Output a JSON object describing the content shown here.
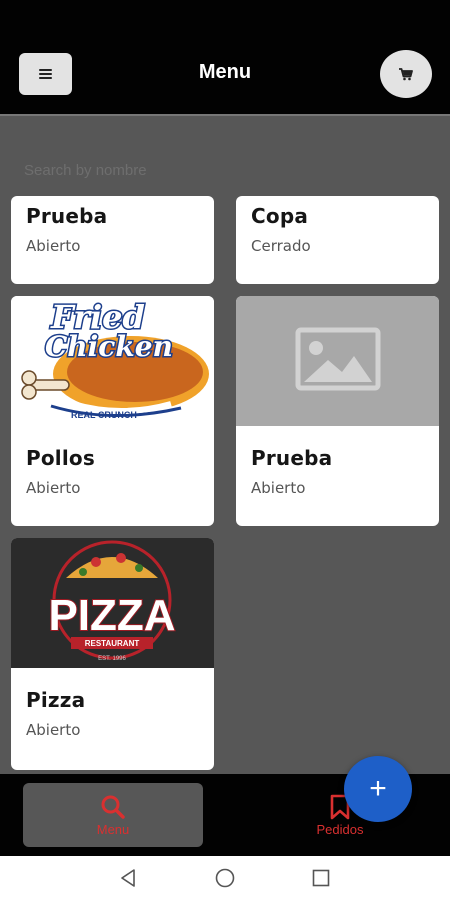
{
  "app_bar": {
    "title": "Menu",
    "menu_icon": "hamburger-icon",
    "cart_icon": "cart-icon"
  },
  "search": {
    "placeholder": "Search by nombre",
    "value": ""
  },
  "restaurants": [
    {
      "name": "Prueba",
      "status": "Abierto",
      "image": "none"
    },
    {
      "name": "Copa",
      "status": "Cerrado",
      "image": "none"
    },
    {
      "name": "Pollos",
      "status": "Abierto",
      "image": "fried-chicken-logo"
    },
    {
      "name": "Prueba",
      "status": "Abierto",
      "image": "image-placeholder-icon"
    },
    {
      "name": "Pizza",
      "status": "Abierto",
      "image": "pizza-restaurant-logo"
    }
  ],
  "logos": {
    "chicken_line1": "Fried",
    "chicken_line2": "Chicken",
    "chicken_tag": "REAL CRUNCH",
    "pizza_word": "PIZZA",
    "pizza_banner": "RESTAURANT",
    "pizza_est": "EST. 1996"
  },
  "bottom_nav": {
    "menu_label": "Menu",
    "orders_label": "Pedidos"
  },
  "fab": {
    "label": "+",
    "icon": "plus-icon"
  },
  "colors": {
    "app_bar": "#020202",
    "content_bg": "#575757",
    "accent_red": "#d93030",
    "fab_blue": "#1e5fc8"
  }
}
